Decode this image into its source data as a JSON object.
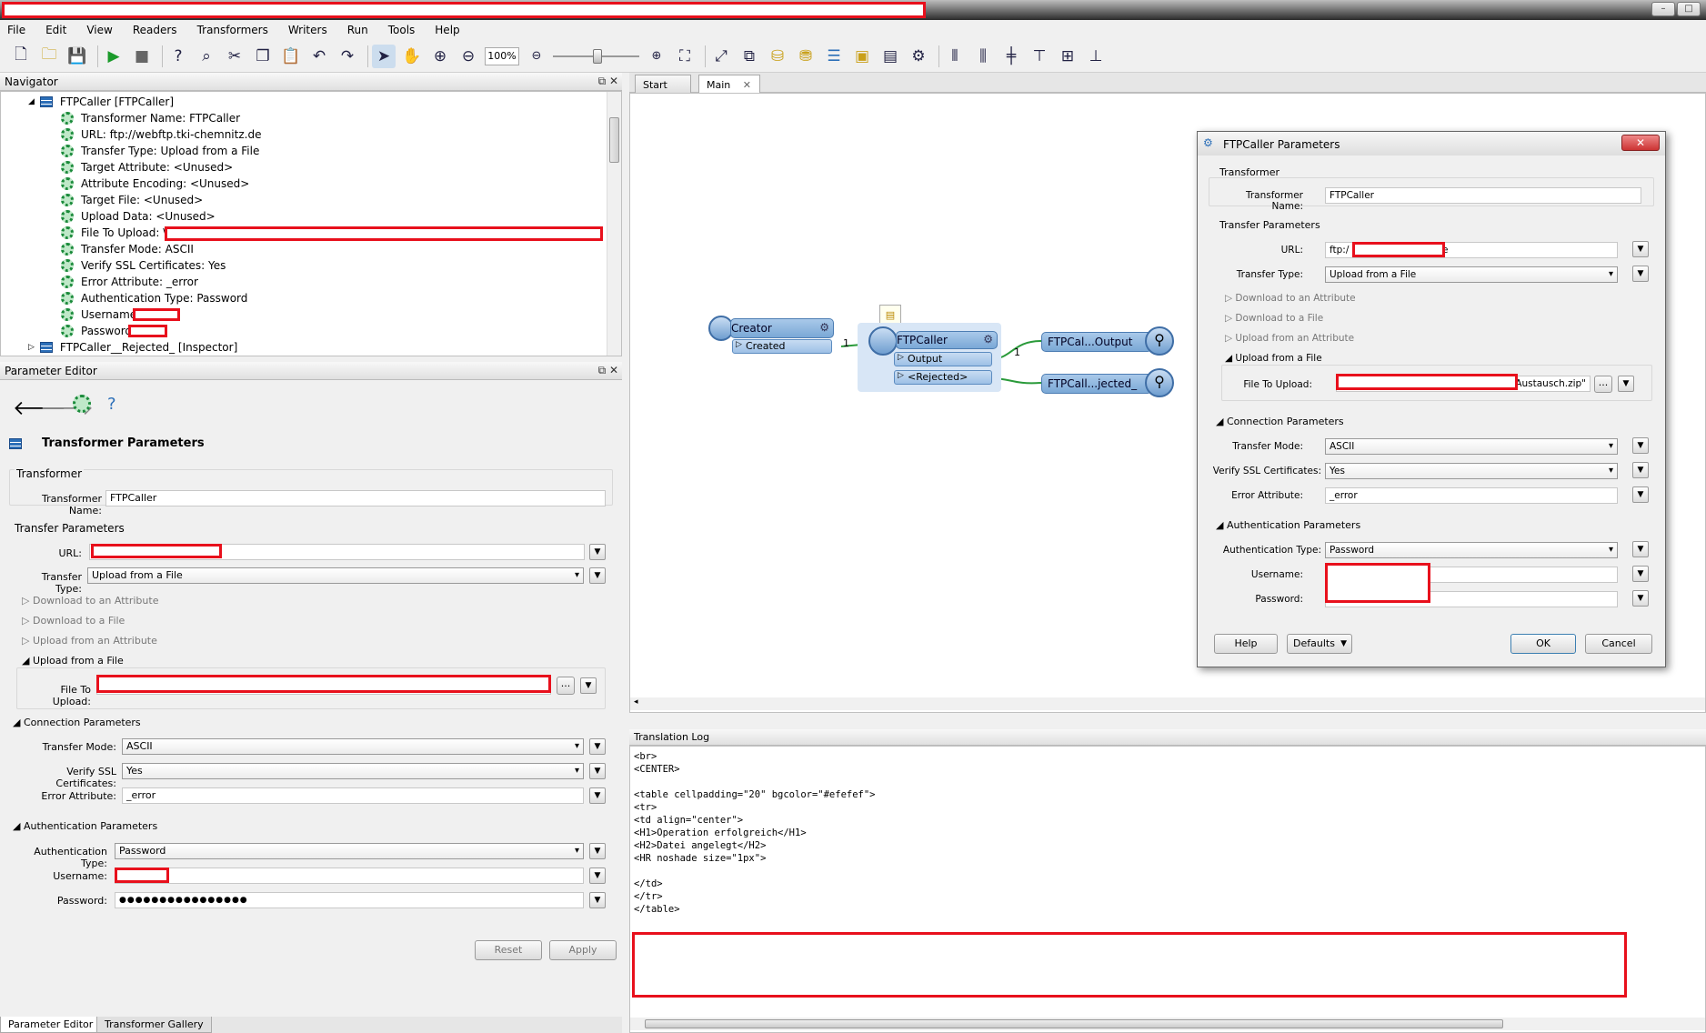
{
  "menu": [
    "File",
    "Edit",
    "View",
    "Readers",
    "Transformers",
    "Writers",
    "Run",
    "Tools",
    "Help"
  ],
  "toolbar": {
    "zoom": "100%"
  },
  "navigator": {
    "title": "Navigator",
    "root": "FTPCaller [FTPCaller]",
    "items": [
      "Transformer Name: FTPCaller",
      "URL: ftp://webftp.tki-chemnitz.de",
      "Transfer Type: Upload from a File",
      "Target Attribute: <Unused>",
      "Attribute Encoding: <Unused>",
      "Target File: <Unused>",
      "Upload Data: <Unused>",
      "File To Upload: \\\\",
      "Transfer Mode: ASCII",
      "Verify SSL Certificates: Yes",
      "Error Attribute: _error",
      "Authentication Type: Password",
      "Username:",
      "Password:"
    ],
    "next": "FTPCaller__Rejected_ [Inspector]"
  },
  "param_editor": {
    "title": "Parameter Editor",
    "heading": "Transformer Parameters",
    "sec_transformer": "Transformer",
    "name_label": "Transformer Name:",
    "name_value": "FTPCaller",
    "sec_transfer": "Transfer Parameters",
    "url_label": "URL:",
    "type_label": "Transfer Type:",
    "type_value": "Upload from a File",
    "c1": "Download to an Attribute",
    "c2": "Download to a File",
    "c3": "Upload from an Attribute",
    "c4": "Upload from a File",
    "file_label": "File To Upload:",
    "sec_conn": "Connection Parameters",
    "mode_label": "Transfer Mode:",
    "mode_value": "ASCII",
    "ssl_label": "Verify SSL Certificates:",
    "ssl_value": "Yes",
    "err_label": "Error Attribute:",
    "err_value": "_error",
    "sec_auth": "Authentication Parameters",
    "auth_label": "Authentication Type:",
    "auth_value": "Password",
    "user_label": "Username:",
    "pass_label": "Password:",
    "pass_value": "●●●●●●●●●●●●●●●●",
    "reset": "Reset",
    "apply": "Apply",
    "browse": "..."
  },
  "canvas": {
    "tabs": [
      "Start",
      "Main"
    ],
    "creator": "Creator",
    "created": "Created",
    "ftpcaller": "FTPCaller",
    "output": "Output",
    "rejected": "<Rejected>",
    "insp1": "FTPCal...Output",
    "insp2": "FTPCall...jected_",
    "one": "1"
  },
  "dialog": {
    "title": "FTPCaller Parameters",
    "sec_transformer": "Transformer",
    "name_label": "Transformer Name:",
    "name_value": "FTPCaller",
    "sec_transfer": "Transfer Parameters",
    "url_label": "URL:",
    "url_prefix": "ftp:/",
    "url_suffix": "de",
    "type_label": "Transfer Type:",
    "type_value": "Upload from a File",
    "c1": "Download to an Attribute",
    "c2": "Download to a File",
    "c3": "Upload from an Attribute",
    "c4": "Upload from a File",
    "file_label": "File To Upload:",
    "file_suffix": "Austausch.zip\"",
    "sec_conn": "Connection Parameters",
    "mode_label": "Transfer Mode:",
    "mode_value": "ASCII",
    "ssl_label": "Verify SSL Certificates:",
    "ssl_value": "Yes",
    "err_label": "Error Attribute:",
    "err_value": "_error",
    "sec_auth": "Authentication Parameters",
    "auth_label": "Authentication Type:",
    "auth_value": "Password",
    "user_label": "Username:",
    "pass_label": "Password:",
    "help": "Help",
    "defaults": "Defaults",
    "ok": "OK",
    "cancel": "Cancel",
    "close": "✕",
    "browse": "..."
  },
  "log": {
    "title": "Translation Log",
    "text": "<br>\n<CENTER>\n\n<table cellpadding=\"20\" bgcolor=\"#efefef\">\n<tr>\n<td align=\"center\">\n<H1>Operation erfolgreich</H1>\n<H2>Datei angelegt</H2>\n<HR noshade size=\"1px\">\n\n</td>\n</tr>\n</table>"
  },
  "bottom_tabs": [
    "Parameter Editor",
    "Transformer Gallery"
  ]
}
